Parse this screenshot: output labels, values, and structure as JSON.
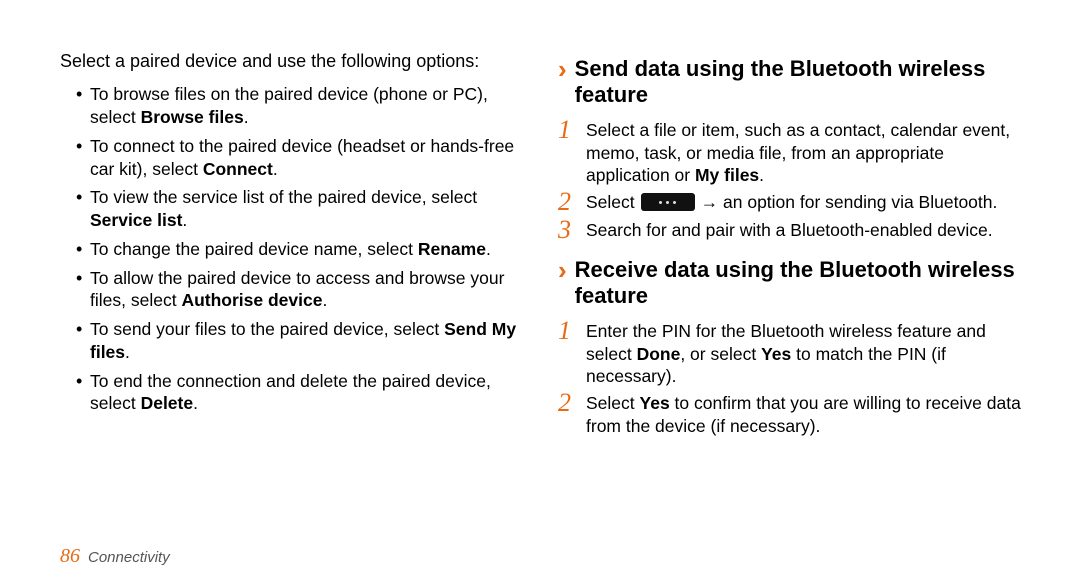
{
  "left": {
    "intro": "Select a paired device and use the following options:",
    "bullets": [
      {
        "pre": "To browse files on the paired device (phone or PC), select ",
        "bold": "Browse files",
        "post": "."
      },
      {
        "pre": "To connect to the paired device (headset or hands-free car kit), select ",
        "bold": "Connect",
        "post": "."
      },
      {
        "pre": "To view the service list of the paired device, select ",
        "bold": "Service list",
        "post": "."
      },
      {
        "pre": "To change the paired device name, select ",
        "bold": "Rename",
        "post": "."
      },
      {
        "pre": "To allow the paired device to access and browse your files, select ",
        "bold": "Authorise device",
        "post": "."
      },
      {
        "pre": "To send your files to the paired device, select ",
        "bold": "Send My files",
        "post": "."
      },
      {
        "pre": "To end the connection and delete the paired device, select ",
        "bold": "Delete",
        "post": "."
      }
    ]
  },
  "right": {
    "send_heading": "Send data using the Bluetooth wireless feature",
    "send_steps": {
      "s1": {
        "t1": "Select a file or item, such as a contact, calendar event, memo, task, or media file, from an appropriate application or ",
        "b": "My files",
        "t2": "."
      },
      "s2": {
        "pre": "Select",
        "post": " → an option for sending via Bluetooth."
      },
      "s3": "Search for and pair with a Bluetooth-enabled device."
    },
    "recv_heading": "Receive data using the Bluetooth wireless feature",
    "recv_steps": {
      "s1": {
        "t1": "Enter the PIN for the Bluetooth wireless feature and select ",
        "b1": "Done",
        "t2": ", or select ",
        "b2": "Yes",
        "t3": " to match the PIN (if necessary)."
      },
      "s2": {
        "t1": "Select ",
        "b": "Yes",
        "t2": " to confirm that you are willing to receive data from the device (if necessary)."
      }
    }
  },
  "footer": {
    "page": "86",
    "section": "Connectivity"
  },
  "nums": {
    "n1": "1",
    "n2": "2",
    "n3": "3"
  },
  "chevron": "›"
}
